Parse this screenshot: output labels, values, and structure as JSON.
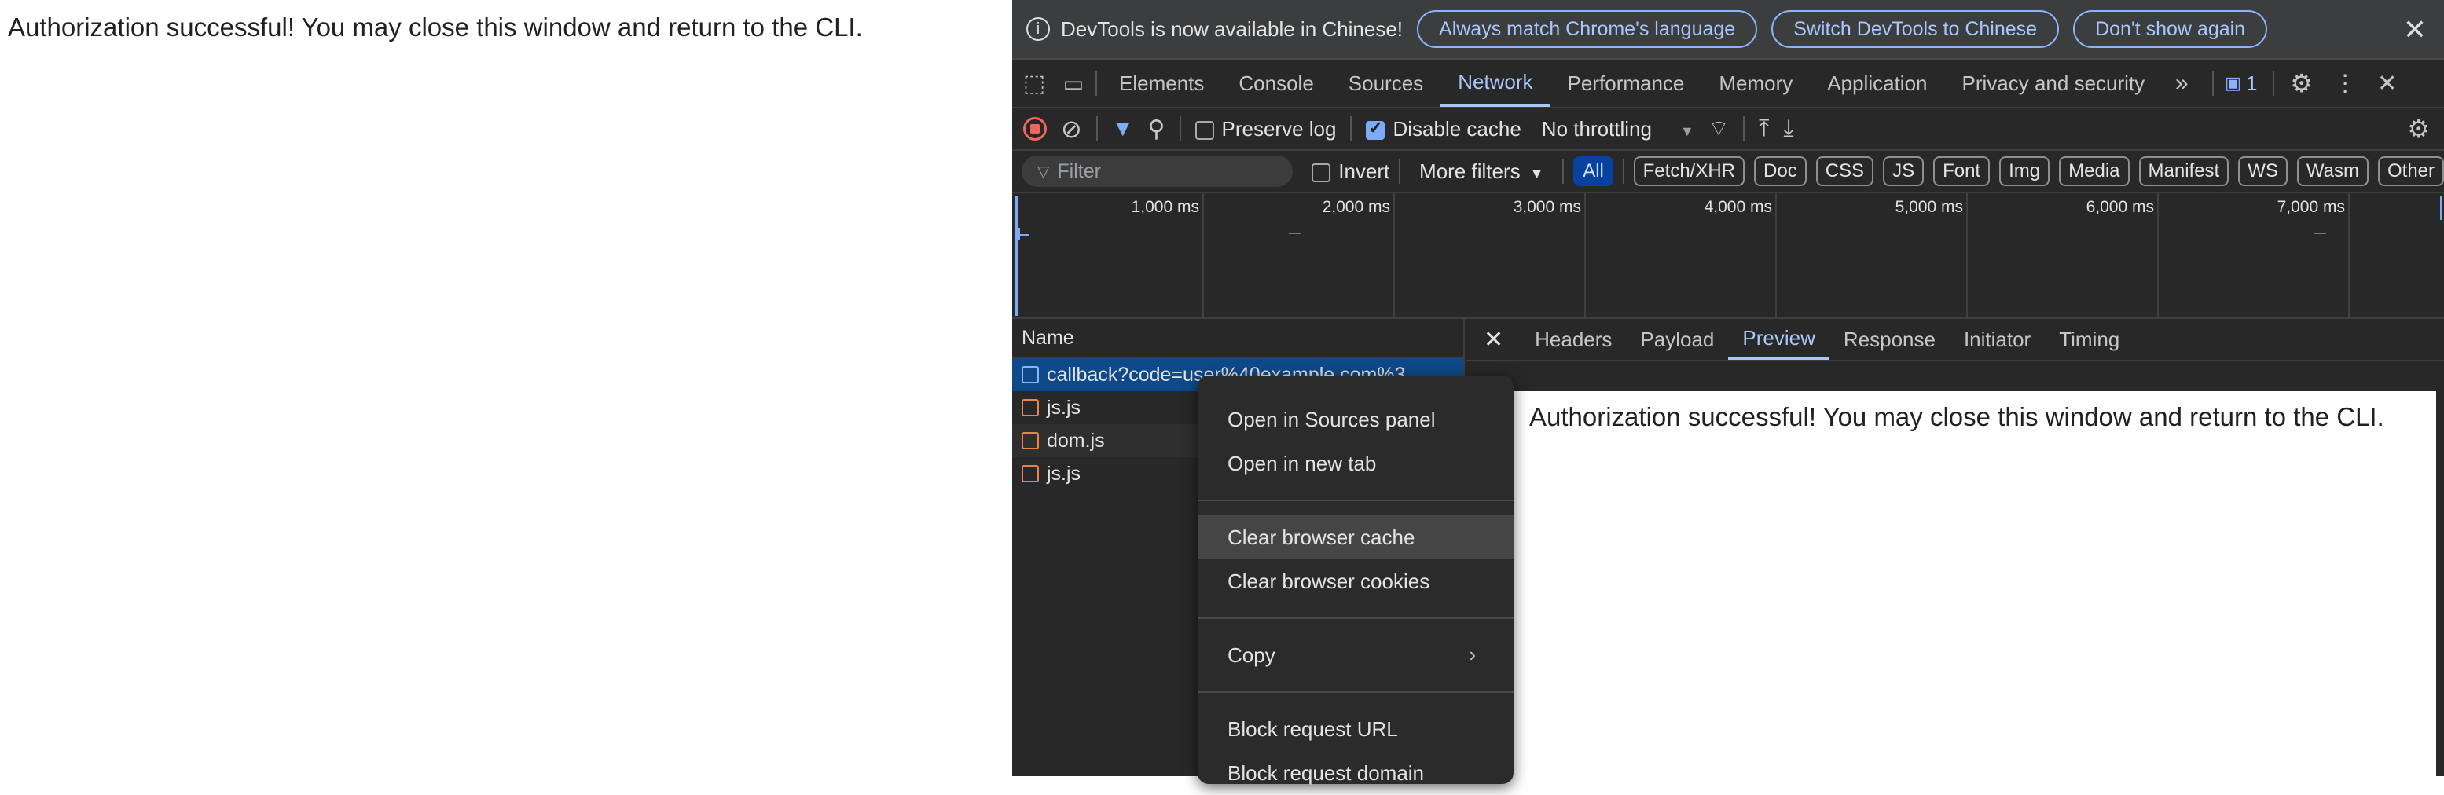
{
  "page": {
    "message": "Authorization successful! You may close this window and return to the CLI."
  },
  "infobar": {
    "message": "DevTools is now available in Chinese!",
    "buttons": [
      "Always match Chrome's language",
      "Switch DevTools to Chinese",
      "Don't show again"
    ]
  },
  "tabs": [
    "Elements",
    "Console",
    "Sources",
    "Network",
    "Performance",
    "Memory",
    "Application",
    "Privacy and security"
  ],
  "tabs_active": "Network",
  "issues_count": "1",
  "toolbar": {
    "preserve_log": "Preserve log",
    "disable_cache": "Disable cache",
    "throttling": "No throttling"
  },
  "filter": {
    "placeholder": "Filter",
    "invert": "Invert",
    "more_filters": "More filters",
    "types": [
      "All",
      "Fetch/XHR",
      "Doc",
      "CSS",
      "JS",
      "Font",
      "Img",
      "Media",
      "Manifest",
      "WS",
      "Wasm",
      "Other"
    ]
  },
  "timeline": {
    "ticks": [
      "1,000 ms",
      "2,000 ms",
      "3,000 ms",
      "4,000 ms",
      "5,000 ms",
      "6,000 ms",
      "7,000 ms"
    ]
  },
  "requests": {
    "header": "Name",
    "items": [
      "callback?code=user%40example.com%3",
      "js.js",
      "dom.js",
      "js.js"
    ]
  },
  "detail": {
    "tabs": [
      "Headers",
      "Payload",
      "Preview",
      "Response",
      "Initiator",
      "Timing"
    ],
    "active": "Preview",
    "preview_text": "Authorization successful! You may close this window and return to the CLI."
  },
  "context_menu": {
    "items": [
      "Open in Sources panel",
      "Open in new tab",
      "Clear browser cache",
      "Clear browser cookies",
      "Copy",
      "Block request URL",
      "Block request domain"
    ],
    "highlighted": "Clear browser cache"
  },
  "colors": {
    "accent": "#a8c7fa",
    "panel_bg": "#282828",
    "selected_row": "#0e4a8a"
  }
}
